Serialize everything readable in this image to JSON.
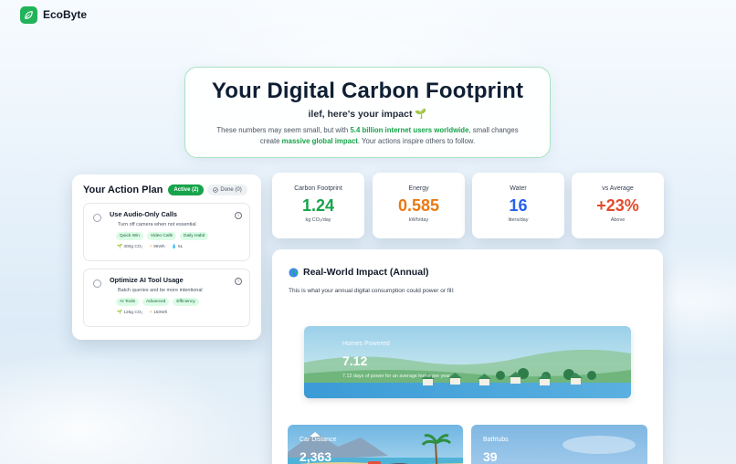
{
  "app": {
    "name": "EcoByte"
  },
  "hero": {
    "title": "Your Digital Carbon Footprint",
    "subtitle": "ilef, here's your impact",
    "desc_part1": "These numbers may seem small, but with ",
    "desc_highlight1": "5.4 billion internet users worldwide",
    "desc_part2": ", small changes create ",
    "desc_highlight2": "massive global impact",
    "desc_part3": ". Your actions inspire others to follow."
  },
  "action_plan": {
    "title": "Your Action Plan",
    "active_label": "Active (2)",
    "done_label": "Done (0)",
    "tasks": [
      {
        "title": "Use Audio-Only Calls",
        "desc": "Turn off camera when not essential",
        "tags": [
          "Quick Win",
          "Video Calls",
          "Daily Habit"
        ],
        "co2": "300g CO₂",
        "energy": "96Wh",
        "water": "5L"
      },
      {
        "title": "Optimize AI Tool Usage",
        "desc": "Batch queries and be more intentional",
        "tags": [
          "AI Tools",
          "Advanced",
          "Efficiency"
        ],
        "co2": "125g CO₂",
        "energy": "150Wh"
      }
    ]
  },
  "stats": [
    {
      "label": "Carbon Footprint",
      "value": "1.24",
      "unit": "kg CO₂/day",
      "color": "#16a34a"
    },
    {
      "label": "Energy",
      "value": "0.585",
      "unit": "kWh/day",
      "color": "#ea7a12"
    },
    {
      "label": "Water",
      "value": "16",
      "unit": "liters/day",
      "color": "#2563eb"
    },
    {
      "label": "vs Average",
      "value": "+23%",
      "unit": "Above",
      "color": "#e34b2b"
    }
  ],
  "impact": {
    "title": "Real-World Impact (Annual)",
    "desc": "This is what your annual digital consumption could power or fill:",
    "cards": {
      "homes": {
        "label": "Homes Powered",
        "value": "7.12",
        "desc": "7.12 days of power for an average home per year"
      },
      "car": {
        "label": "Car Distance",
        "value": "2,363"
      },
      "bath": {
        "label": "Bathtubs",
        "value": "39"
      }
    }
  },
  "colors": {
    "brand": "#22b35a",
    "accent": "#16a34a"
  }
}
